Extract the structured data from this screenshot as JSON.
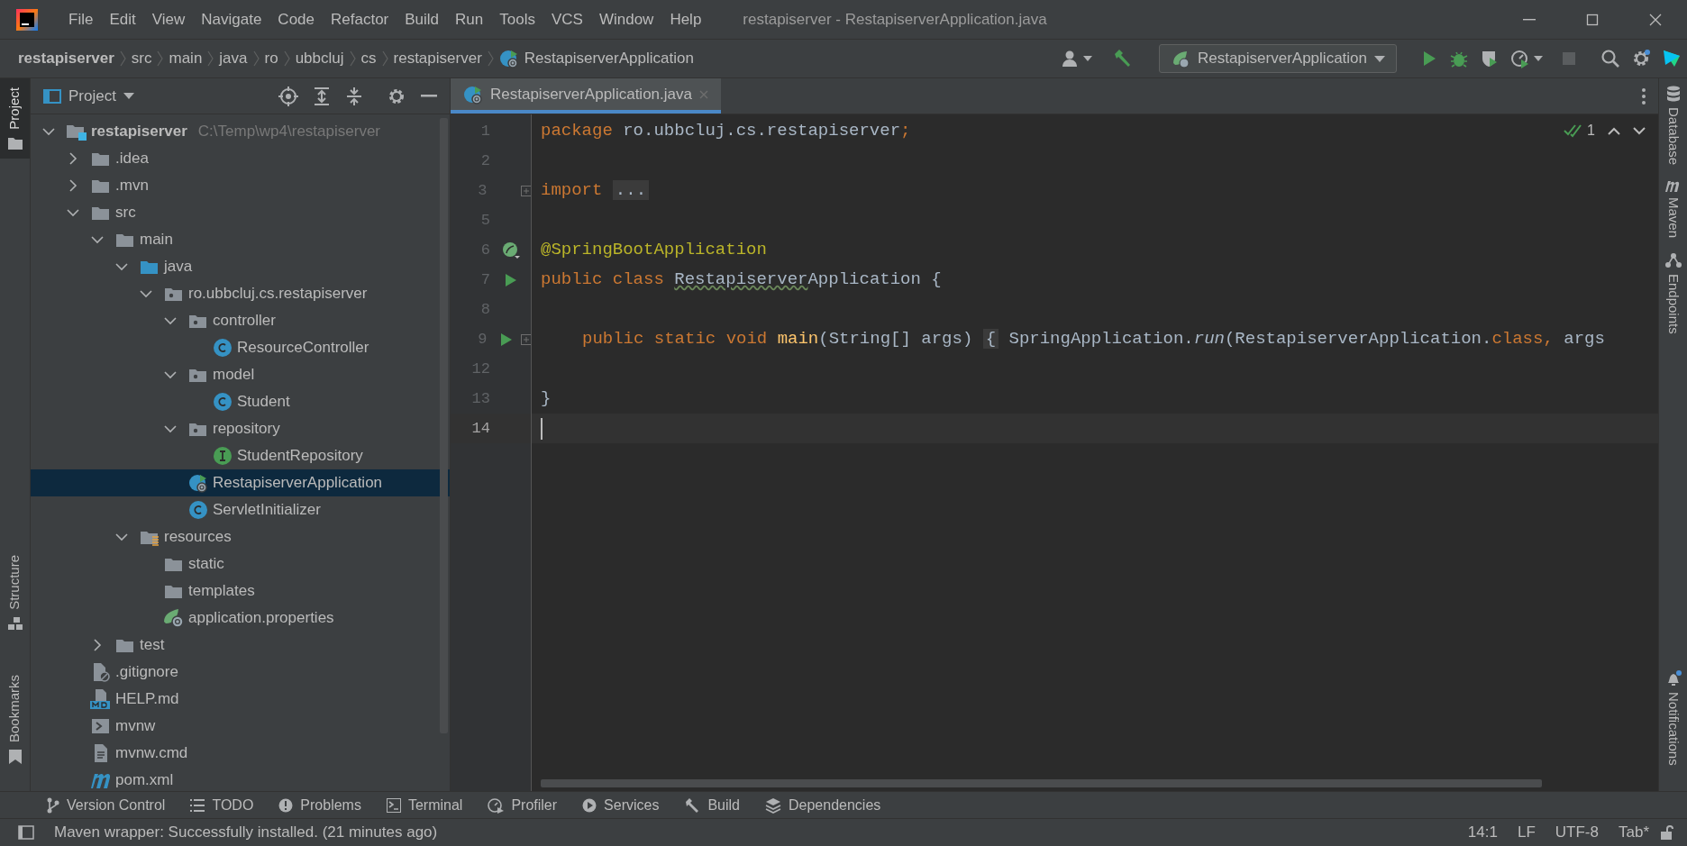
{
  "window": {
    "title": "restapiserver - RestapiserverApplication.java"
  },
  "menu": [
    "File",
    "Edit",
    "View",
    "Navigate",
    "Code",
    "Refactor",
    "Build",
    "Run",
    "Tools",
    "VCS",
    "Window",
    "Help"
  ],
  "breadcrumbs": [
    {
      "label": "restapiserver",
      "kind": "module"
    },
    {
      "label": "src",
      "kind": "plain"
    },
    {
      "label": "main",
      "kind": "plain"
    },
    {
      "label": "java",
      "kind": "plain"
    },
    {
      "label": "ro",
      "kind": "plain"
    },
    {
      "label": "ubbcluj",
      "kind": "plain"
    },
    {
      "label": "cs",
      "kind": "plain"
    },
    {
      "label": "restapiserver",
      "kind": "plain"
    },
    {
      "label": "RestapiserverApplication",
      "kind": "spring-app"
    }
  ],
  "run_configuration": "RestapiserverApplication",
  "left_stripe": [
    {
      "label": "Project",
      "selected": true,
      "kind": "project"
    },
    {
      "label": "Structure",
      "selected": false,
      "kind": "structure"
    },
    {
      "label": "Bookmarks",
      "selected": false,
      "kind": "bookmarks"
    }
  ],
  "right_stripe": [
    {
      "label": "Database",
      "kind": "database"
    },
    {
      "label": "Maven",
      "kind": "maven"
    },
    {
      "label": "Endpoints",
      "kind": "endpoints"
    },
    {
      "label": "Notifications",
      "kind": "notifications"
    }
  ],
  "project_panel": {
    "title": "Project"
  },
  "tree": [
    {
      "label": "restapiserver",
      "path": "C:\\Temp\\wp4\\restapiserver",
      "kind": "module",
      "expanded": true,
      "selected": false,
      "children": [
        {
          "label": ".idea",
          "kind": "folder",
          "expanded": false,
          "selected": false
        },
        {
          "label": ".mvn",
          "kind": "folder",
          "expanded": false,
          "selected": false
        },
        {
          "label": "src",
          "kind": "folder",
          "expanded": true,
          "selected": false,
          "children": [
            {
              "label": "main",
              "kind": "folder",
              "expanded": true,
              "selected": false,
              "children": [
                {
                  "label": "java",
                  "kind": "source-folder",
                  "expanded": true,
                  "selected": false,
                  "children": [
                    {
                      "label": "ro.ubbcluj.cs.restapiserver",
                      "kind": "package",
                      "expanded": true,
                      "selected": false,
                      "children": [
                        {
                          "label": "controller",
                          "kind": "package",
                          "expanded": true,
                          "selected": false,
                          "children": [
                            {
                              "label": "ResourceController",
                              "kind": "class",
                              "selected": false
                            }
                          ]
                        },
                        {
                          "label": "model",
                          "kind": "package",
                          "expanded": true,
                          "selected": false,
                          "children": [
                            {
                              "label": "Student",
                              "kind": "class",
                              "selected": false
                            }
                          ]
                        },
                        {
                          "label": "repository",
                          "kind": "package",
                          "expanded": true,
                          "selected": false,
                          "children": [
                            {
                              "label": "StudentRepository",
                              "kind": "interface",
                              "selected": false
                            }
                          ]
                        },
                        {
                          "label": "RestapiserverApplication",
                          "kind": "spring-app",
                          "selected": true
                        },
                        {
                          "label": "ServletInitializer",
                          "kind": "class",
                          "selected": false
                        }
                      ]
                    }
                  ]
                },
                {
                  "label": "resources",
                  "kind": "resources-folder",
                  "expanded": true,
                  "selected": false,
                  "children": [
                    {
                      "label": "static",
                      "kind": "folder",
                      "selected": false
                    },
                    {
                      "label": "templates",
                      "kind": "folder",
                      "selected": false
                    },
                    {
                      "label": "application.properties",
                      "kind": "properties",
                      "selected": false
                    }
                  ]
                }
              ]
            },
            {
              "label": "test",
              "kind": "folder",
              "expanded": false,
              "selected": false
            }
          ]
        },
        {
          "label": ".gitignore",
          "kind": "ignore-file",
          "selected": false
        },
        {
          "label": "HELP.md",
          "kind": "markdown",
          "selected": false
        },
        {
          "label": "mvnw",
          "kind": "script",
          "selected": false
        },
        {
          "label": "mvnw.cmd",
          "kind": "text-file",
          "selected": false
        },
        {
          "label": "pom.xml",
          "kind": "maven",
          "selected": false
        }
      ]
    }
  ],
  "tabs": [
    {
      "label": "RestapiserverApplication.java",
      "selected": true
    }
  ],
  "editor": {
    "inspection_count": "1",
    "lines": [
      {
        "number": "1",
        "current": false,
        "tokens": [
          {
            "kind": "keyword",
            "text": "package "
          },
          {
            "kind": "plain",
            "text": "ro.ubbcluj.cs.restapiserver"
          },
          {
            "kind": "keyword",
            "text": ";"
          }
        ]
      },
      {
        "number": "2",
        "current": false
      },
      {
        "number": "3",
        "current": false,
        "fold": true,
        "tokens": [
          {
            "kind": "keyword",
            "text": "import "
          },
          {
            "kind": "folded",
            "text": "..."
          }
        ]
      },
      {
        "number": "5",
        "current": false
      },
      {
        "number": "6",
        "current": false,
        "gutter": {
          "kind": "bean"
        },
        "tokens": [
          {
            "kind": "annotation",
            "text": "@SpringBootApplication"
          }
        ]
      },
      {
        "number": "7",
        "current": false,
        "gutter": {
          "kind": "run"
        },
        "tokens": [
          {
            "kind": "keyword",
            "text": "public class "
          },
          {
            "kind": "squiggle",
            "text": "Restapiserver"
          },
          {
            "kind": "plain",
            "text": "Application {"
          }
        ]
      },
      {
        "number": "8",
        "current": false
      },
      {
        "number": "9",
        "current": false,
        "indented": true,
        "gutter": {
          "kind": "run"
        },
        "fold": true,
        "tokens": [
          {
            "kind": "keyword",
            "text": "public static void "
          },
          {
            "kind": "method",
            "text": "main"
          },
          {
            "kind": "plain",
            "text": "(String[] args) "
          },
          {
            "kind": "folded",
            "text": "{"
          },
          {
            "kind": "plain",
            "text": " SpringApplication."
          },
          {
            "kind": "italic",
            "text": "run"
          },
          {
            "kind": "plain",
            "text": "(RestapiserverApplication."
          },
          {
            "kind": "keyword",
            "text": "class"
          },
          {
            "kind": "keyword",
            "text": ", "
          },
          {
            "kind": "plain",
            "text": "args"
          }
        ]
      },
      {
        "number": "12",
        "current": false
      },
      {
        "number": "13",
        "current": false,
        "tokens": [
          {
            "kind": "plain",
            "text": "}"
          }
        ]
      },
      {
        "number": "14",
        "current": true
      }
    ]
  },
  "tool_windows": [
    {
      "label": "Version Control",
      "kind": "vcs"
    },
    {
      "label": "TODO",
      "kind": "todo"
    },
    {
      "label": "Problems",
      "kind": "problems"
    },
    {
      "label": "Terminal",
      "kind": "terminal"
    },
    {
      "label": "Profiler",
      "kind": "profiler"
    },
    {
      "label": "Services",
      "kind": "services"
    },
    {
      "label": "Build",
      "kind": "build"
    },
    {
      "label": "Dependencies",
      "kind": "dependencies"
    }
  ],
  "status_bar": {
    "message": "Maven wrapper: Successfully installed. (21 minutes ago)",
    "items": [
      "14:1",
      "LF",
      "UTF-8",
      "Tab*"
    ]
  }
}
